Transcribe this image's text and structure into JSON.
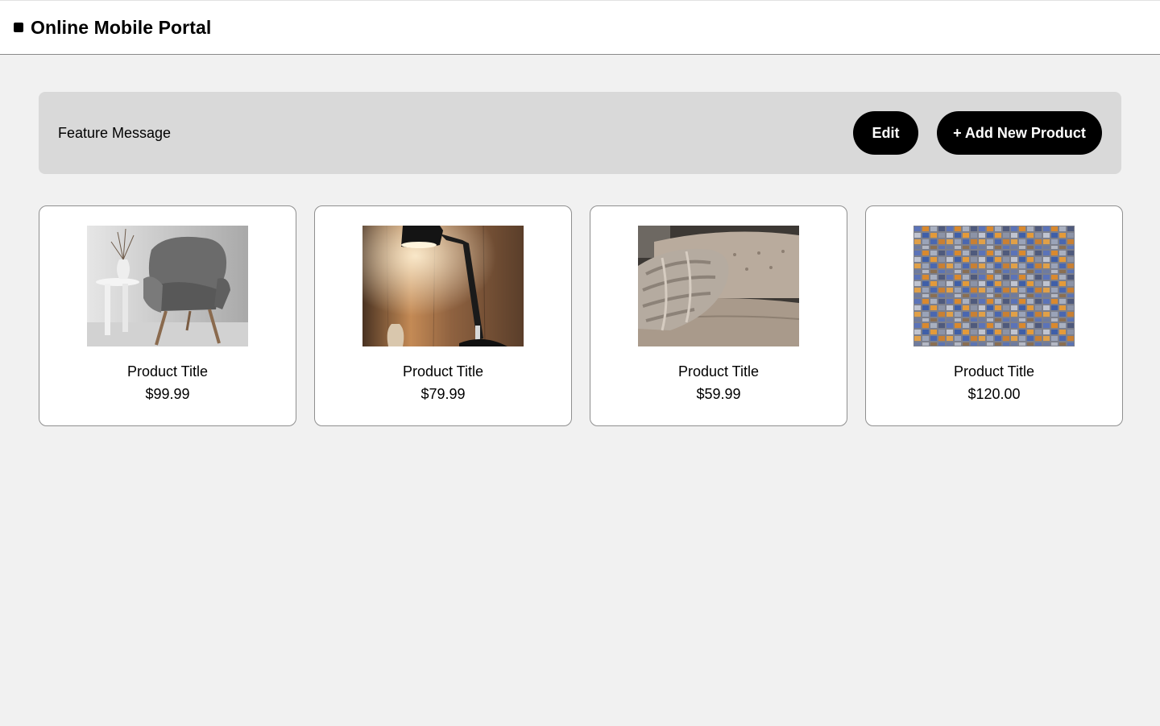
{
  "header": {
    "logo_icon": "square-logo-icon",
    "title": "Online Mobile Portal"
  },
  "banner": {
    "message": "Feature Message",
    "edit_label": "Edit",
    "add_label": "+ Add New Product"
  },
  "products": [
    {
      "title": "Product Title",
      "price": "$99.99",
      "image": "armchair-image"
    },
    {
      "title": "Product Title",
      "price": "$79.99",
      "image": "desk-lamp-image"
    },
    {
      "title": "Product Title",
      "price": "$59.99",
      "image": "knit-blanket-image"
    },
    {
      "title": "Product Title",
      "price": "$120.00",
      "image": "mosaic-tile-image"
    }
  ],
  "colors": {
    "page_background": "#f1f1f1",
    "banner_background": "#d9d9d9",
    "button_background": "#000000",
    "button_text": "#ffffff"
  }
}
